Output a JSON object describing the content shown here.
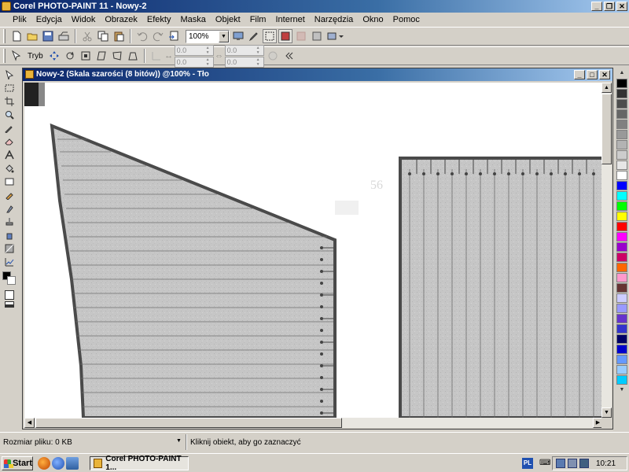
{
  "app": {
    "title": "Corel PHOTO-PAINT 11 - Nowy-2"
  },
  "window_controls": {
    "minimize": "_",
    "restore": "❐",
    "close": "✕"
  },
  "menu": [
    {
      "label": "Plik"
    },
    {
      "label": "Edycja"
    },
    {
      "label": "Widok"
    },
    {
      "label": "Obrazek"
    },
    {
      "label": "Efekty"
    },
    {
      "label": "Maska"
    },
    {
      "label": "Objekt"
    },
    {
      "label": "Film"
    },
    {
      "label": "Internet"
    },
    {
      "label": "Narzędzia"
    },
    {
      "label": "Okno"
    },
    {
      "label": "Pomoc"
    }
  ],
  "toolbar": {
    "zoom_value": "100%",
    "mode_label": "Tryb",
    "spin_values": [
      "0.0",
      "0.0",
      "0.0",
      "0.0"
    ]
  },
  "document": {
    "title": "Nowy-2 (Skala szarości (8 bitów)) @100% - Tło"
  },
  "palette": {
    "up": "▲",
    "down": "▼",
    "colors": [
      "#000000",
      "#333333",
      "#4d4d4d",
      "#666666",
      "#808080",
      "#999999",
      "#b3b3b3",
      "#cccccc",
      "#e6e6e6",
      "#ffffff",
      "#0000ff",
      "#00ffff",
      "#00ff00",
      "#ffff00",
      "#ff0000",
      "#ff00ff",
      "#9900cc",
      "#cc0066",
      "#ff6600",
      "#ff99cc",
      "#663333",
      "#ccccff",
      "#9999ff",
      "#6633cc",
      "#3333cc",
      "#000066",
      "#0000cc",
      "#6699ff",
      "#99ccff",
      "#00ccff"
    ]
  },
  "status": {
    "file_size": "Rozmiar pliku: 0 KB",
    "hint": "Kliknij obiekt, aby go zaznaczyć"
  },
  "taskbar": {
    "start_label": "Start",
    "task_label": "Corel PHOTO-PAINT 1...",
    "language": "PL",
    "clock": "10:21"
  }
}
